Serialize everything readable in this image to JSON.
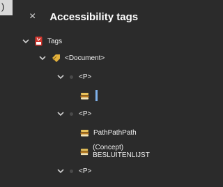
{
  "edge": {
    "glyph": ")"
  },
  "panel": {
    "title": "Accessibility tags",
    "close_glyph": "×"
  },
  "tree": {
    "root": {
      "label": "Tags",
      "icon": "pdf-tags-icon",
      "expanded": true
    },
    "document": {
      "label": "<Document>",
      "icon": "tag-icon",
      "expanded": true
    },
    "p1": {
      "label": "<P>",
      "expanded": true
    },
    "p2": {
      "label": "<P>",
      "expanded": true
    },
    "p2_item1": {
      "label": "PathPathPath",
      "icon": "content-icon"
    },
    "p2_item2": {
      "label": "(Concept) BESLUITENLIJST",
      "icon": "content-icon"
    },
    "p3": {
      "label": "<P>",
      "expanded": true
    }
  },
  "colors": {
    "background": "#2b2b2b",
    "text": "#f0f0f0",
    "accent": "#7fb1ea",
    "pdf_red": "#d0342c"
  }
}
